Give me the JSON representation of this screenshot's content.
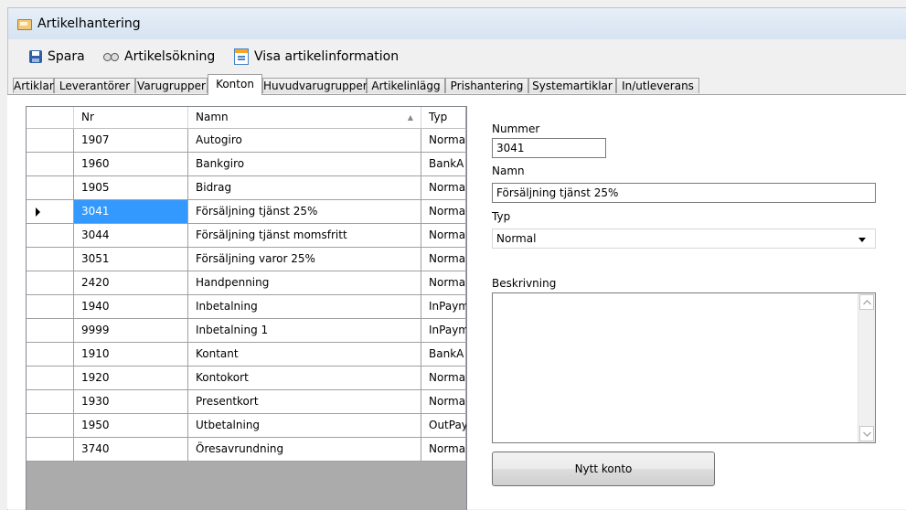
{
  "window": {
    "title": "Artikelhantering"
  },
  "toolbar": {
    "save_label": "Spara",
    "search_label": "Artikelsökning",
    "info_label": "Visa artikelinformation"
  },
  "tabs": [
    {
      "label": "Artiklar"
    },
    {
      "label": "Leverantörer"
    },
    {
      "label": "Varugrupper"
    },
    {
      "label": "Konton",
      "active": true
    },
    {
      "label": "Huvudvarugrupper"
    },
    {
      "label": "Artikelinlägg"
    },
    {
      "label": "Prishantering"
    },
    {
      "label": "Systemartiklar"
    },
    {
      "label": "In/utleverans"
    }
  ],
  "grid": {
    "columns": {
      "nr": "Nr",
      "namn": "Namn",
      "typ": "Typ"
    },
    "selected_index": 3,
    "rows": [
      {
        "nr": "1907",
        "namn": "Autogiro",
        "typ": "Normal"
      },
      {
        "nr": "1960",
        "namn": "Bankgiro",
        "typ": "BankA"
      },
      {
        "nr": "1905",
        "namn": "Bidrag",
        "typ": "Normal"
      },
      {
        "nr": "3041",
        "namn": "Försäljning tjänst 25%",
        "typ": "Normal"
      },
      {
        "nr": "3044",
        "namn": "Försäljning tjänst momsfritt",
        "typ": "Normal"
      },
      {
        "nr": "3051",
        "namn": "Försäljning varor 25%",
        "typ": "Normal"
      },
      {
        "nr": "2420",
        "namn": "Handpenning",
        "typ": "Normal"
      },
      {
        "nr": "1940",
        "namn": "Inbetalning",
        "typ": "InPaym"
      },
      {
        "nr": "9999",
        "namn": "Inbetalning 1",
        "typ": "InPaym"
      },
      {
        "nr": "1910",
        "namn": "Kontant",
        "typ": "BankA"
      },
      {
        "nr": "1920",
        "namn": "Kontokort",
        "typ": "Normal"
      },
      {
        "nr": "1930",
        "namn": "Presentkort",
        "typ": "Normal"
      },
      {
        "nr": "1950",
        "namn": "Utbetalning",
        "typ": "OutPay"
      },
      {
        "nr": "3740",
        "namn": "Öresavrundning",
        "typ": "Normal"
      }
    ]
  },
  "form": {
    "nummer_label": "Nummer",
    "nummer_value": "3041",
    "namn_label": "Namn",
    "namn_value": "Försäljning tjänst 25%",
    "typ_label": "Typ",
    "typ_value": "Normal",
    "beskrivning_label": "Beskrivning",
    "beskrivning_value": "",
    "new_account_button": "Nytt konto"
  }
}
